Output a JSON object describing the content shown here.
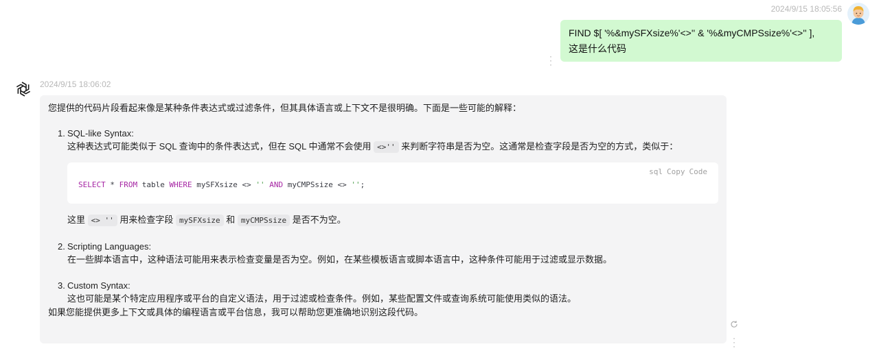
{
  "user": {
    "timestamp": "2024/9/15 18:05:56",
    "message_line1": "FIND $[ '%&mySFXsize%'<>'' & '%&myCMPSsize%'<>'' ],",
    "message_line2": "这是什么代码"
  },
  "bot": {
    "timestamp": "2024/9/15 18:06:02",
    "intro": "您提供的代码片段看起来像是某种条件表达式或过滤条件，但其具体语言或上下文不是很明确。下面是一些可能的解释：",
    "items": [
      {
        "num": "1.",
        "title": "SQL-like Syntax:",
        "desc_before": "这种表达式可能类似于 SQL 查询中的条件表达式，但在 SQL 中通常不会使用",
        "desc_code": "<>''",
        "desc_after": "来判断字符串是否为空。这通常是检查字段是否为空的方式，类似于：",
        "code": {
          "lang": "sql",
          "copy": "Copy",
          "code_label": "Code",
          "line": {
            "t1": "SELECT",
            "t2": " * ",
            "t3": "FROM",
            "t4": " table ",
            "t5": "WHERE",
            "t6": " mySFXsize <> ",
            "t7": "''",
            "t8": " ",
            "t9": "AND",
            "t10": " myCMPSsize <> ",
            "t11": "''",
            "t12": ";"
          }
        },
        "after_1": "这里",
        "after_code1": "<> ''",
        "after_2": "用来检查字段",
        "after_code2": "mySFXsize",
        "after_3": "和",
        "after_code3": "myCMPSsize",
        "after_4": "是否不为空。"
      },
      {
        "num": "2.",
        "title": "Scripting Languages:",
        "desc": "在一些脚本语言中，这种语法可能用来表示检查变量是否为空。例如，在某些模板语言或脚本语言中，这种条件可能用于过滤或显示数据。"
      },
      {
        "num": "3.",
        "title": "Custom Syntax:",
        "desc": "这也可能是某个特定应用程序或平台的自定义语法，用于过滤或检查条件。例如，某些配置文件或查询系统可能使用类似的语法。"
      }
    ],
    "outro": "如果您能提供更多上下文或具体的编程语言或平台信息，我可以帮助您更准确地识别这段代码。"
  },
  "icons": {
    "user_avatar": "avatar-icon",
    "bot_logo": "openai-logo-icon",
    "more": "kebab-menu-icon",
    "regenerate": "refresh-icon"
  }
}
